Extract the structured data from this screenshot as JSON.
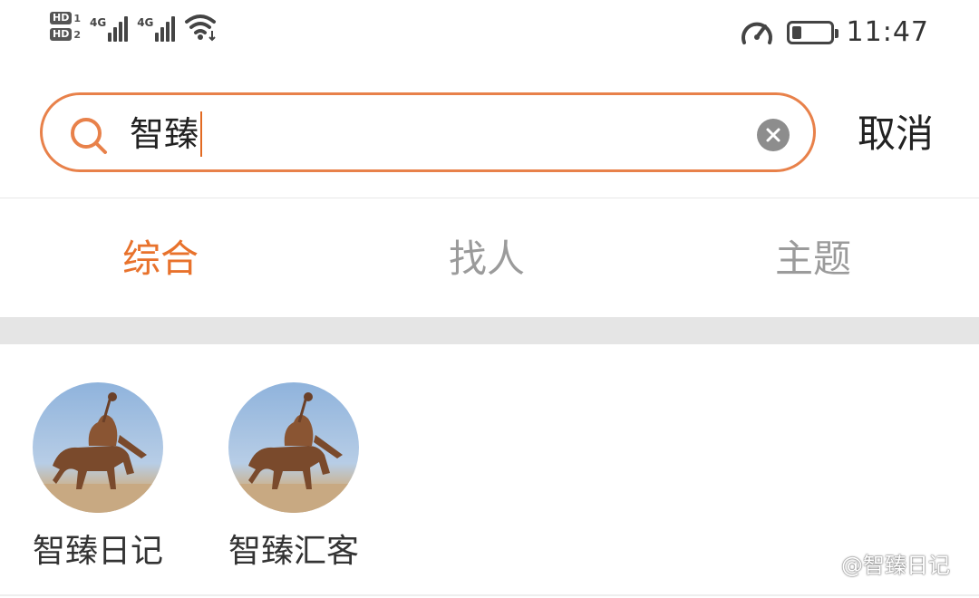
{
  "status_bar": {
    "sim1": "HD",
    "sim1_num": "1",
    "sim2": "HD",
    "sim2_num": "2",
    "network1": "4G",
    "network2": "4G",
    "time": "11:47",
    "battery_level": 0.25,
    "icons": [
      "signal-icon",
      "wifi-icon",
      "speed-icon",
      "battery-icon"
    ]
  },
  "search": {
    "query": "智臻",
    "cancel_label": "取消",
    "accent_color": "#e8814a"
  },
  "tabs": [
    {
      "label": "综合",
      "active": true
    },
    {
      "label": "找人",
      "active": false
    },
    {
      "label": "主题",
      "active": false
    }
  ],
  "results": {
    "users": [
      {
        "name": "智臻日记"
      },
      {
        "name": "智臻汇客"
      }
    ]
  },
  "watermark": "@智臻日记"
}
